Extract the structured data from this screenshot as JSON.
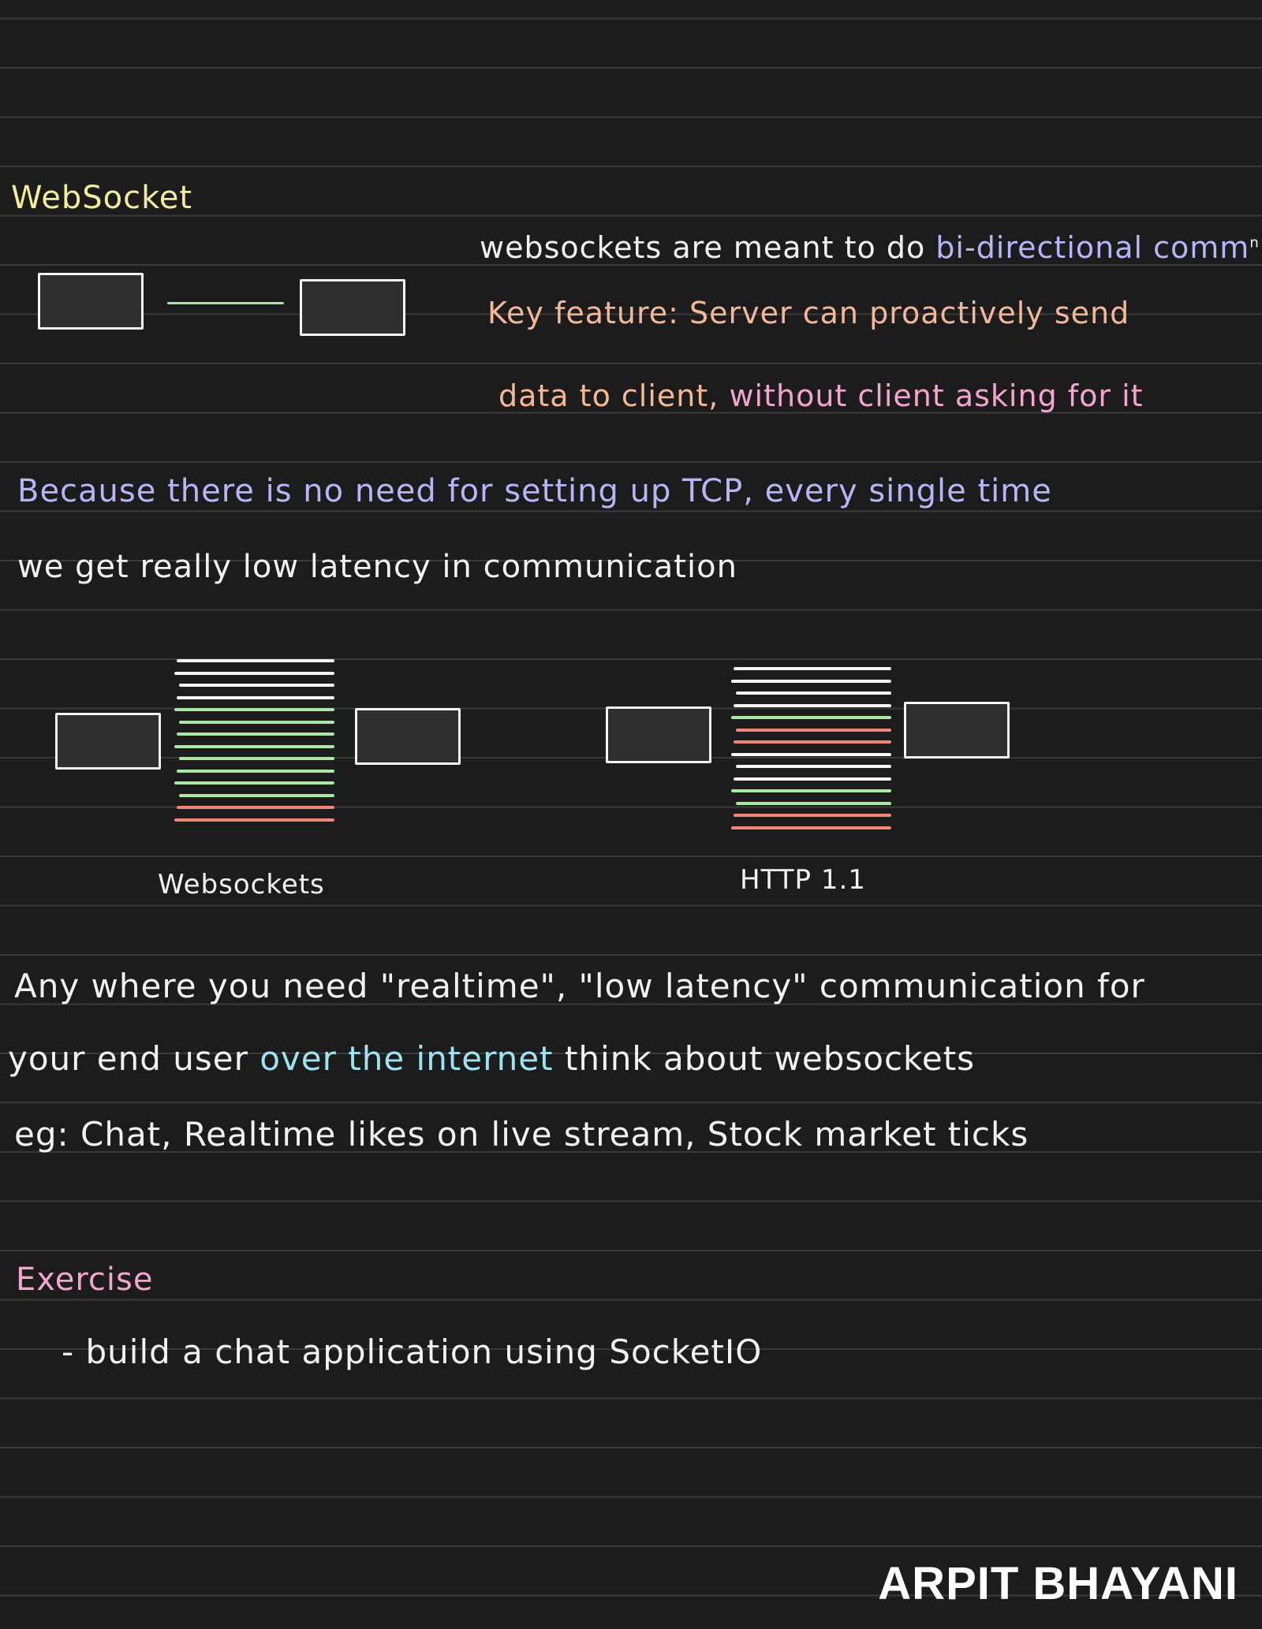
{
  "heading": "WebSocket",
  "websocket_desc": {
    "line1_a": "websockets are meant to do",
    "line1_b": "bi-directional comm",
    "line1_c": "n",
    "line2": "Key feature: Server can proactively send",
    "line3_a": "data to client,",
    "line3_b": "without client asking for it"
  },
  "latency": {
    "line1": "Because there is no need for setting up TCP, every single time",
    "line2": "we get really low latency in communication"
  },
  "diagram": {
    "websockets_caption": "Websockets",
    "http_caption": "HTTP 1.1",
    "ws_stack": [
      "w",
      "w",
      "w",
      "w",
      "g",
      "g",
      "g",
      "g",
      "g",
      "g",
      "g",
      "g",
      "r",
      "r"
    ],
    "http_stack": [
      "w",
      "w",
      "w",
      "w",
      "g",
      "r",
      "r",
      "w",
      "w",
      "w",
      "g",
      "g",
      "r",
      "r"
    ],
    "colors": {
      "request": "#f5f5f5",
      "response": "#a8e7a4",
      "push": "#f0857a"
    }
  },
  "usage": {
    "line1": "Any where you need \"realtime\", \"low latency\" communication for",
    "line2_a": "your end user",
    "line2_b": "over the internet",
    "line2_c": "think about websockets",
    "line3": "eg: Chat, Realtime likes on live stream, Stock market ticks"
  },
  "exercise": {
    "title": "Exercise",
    "item": "- build a chat application using SocketIO"
  },
  "brand": "ARPIT BHAYANI"
}
